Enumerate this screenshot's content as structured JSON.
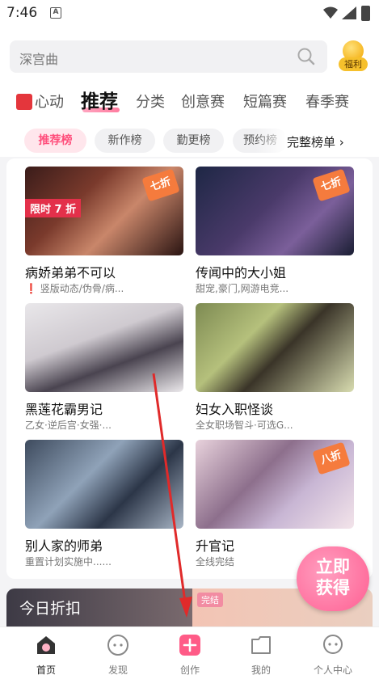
{
  "status_bar": {
    "time": "7:46",
    "notification": "A"
  },
  "search": {
    "placeholder": "深宫曲"
  },
  "welfare": {
    "label": "福利"
  },
  "categories": [
    {
      "label": "心动"
    },
    {
      "label": "推荐"
    },
    {
      "label": "分类"
    },
    {
      "label": "创意赛"
    },
    {
      "label": "短篇赛"
    },
    {
      "label": "春季赛"
    }
  ],
  "sub_tabs": [
    {
      "label": "推荐榜"
    },
    {
      "label": "新作榜"
    },
    {
      "label": "勤更榜"
    },
    {
      "label": "预约榜"
    }
  ],
  "full_ranking": "完整榜单",
  "books": [
    {
      "title": "病娇弟弟不可以",
      "subtitle": "竖版动态/伪骨/病...",
      "warn": "❗",
      "discount": "七折",
      "limited": "限时 7 折"
    },
    {
      "title": "传闻中的大小姐",
      "subtitle": "甜宠,豪门,网游电竞...",
      "discount": "七折"
    },
    {
      "title": "黑莲花霸男记",
      "subtitle": "乙女·逆后宫·女强·..."
    },
    {
      "title": "妇女入职怪谈",
      "subtitle": "全女职场智斗·可选G..."
    },
    {
      "title": "别人家的师弟",
      "subtitle": "重置计划实施中......"
    },
    {
      "title": "升官记",
      "subtitle": "全线完结",
      "discount": "八折"
    }
  ],
  "today_discount": "今日折扣",
  "finished_tag": "完结",
  "floater": {
    "line1": "立即",
    "line2": "获得"
  },
  "nav": [
    {
      "label": "首页"
    },
    {
      "label": "发现"
    },
    {
      "label": "创作"
    },
    {
      "label": "我的"
    },
    {
      "label": "个人中心"
    }
  ],
  "colors": {
    "accent": "#ff4f7c",
    "discount": "#f57b3d",
    "active_nav": "#ff5b87"
  }
}
